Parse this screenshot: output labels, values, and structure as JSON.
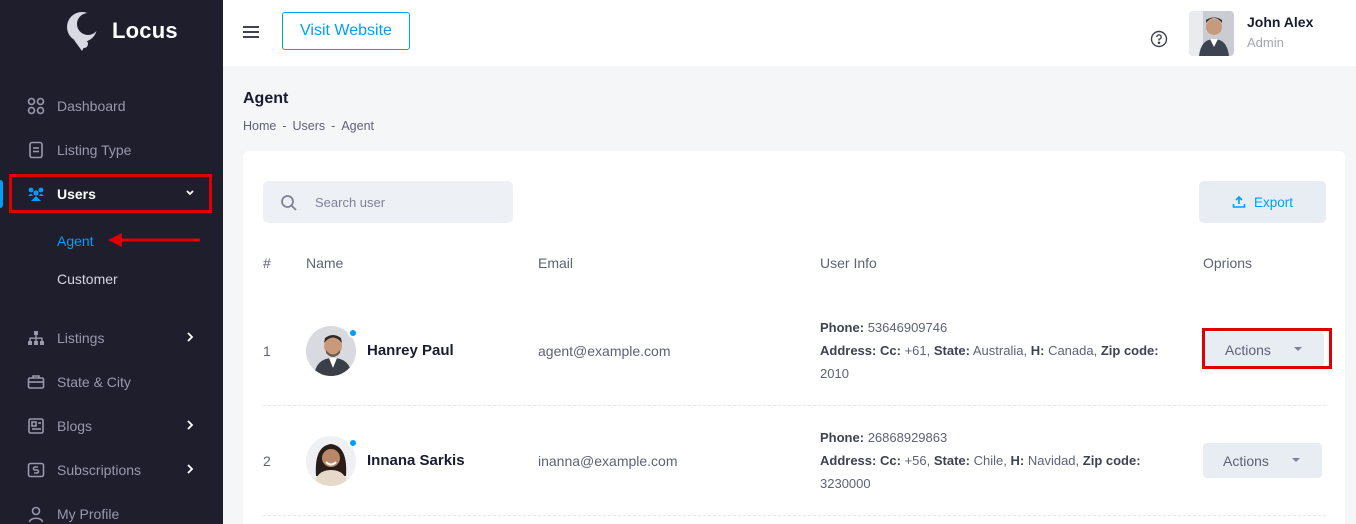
{
  "app": {
    "name": "Locus"
  },
  "colors": {
    "sidebar_bg": "#1e1e2d",
    "accent": "#009ef7",
    "highlight": "#e00000"
  },
  "sidebar": {
    "items": [
      {
        "label": "Dashboard",
        "icon": "dashboard-icon"
      },
      {
        "label": "Listing Type",
        "icon": "document-icon"
      },
      {
        "label": "Users",
        "icon": "users-icon",
        "active": true,
        "expanded": true
      },
      {
        "label": "Listings",
        "icon": "sitemap-icon"
      },
      {
        "label": "State & City",
        "icon": "briefcase-icon"
      },
      {
        "label": "Blogs",
        "icon": "newspaper-icon"
      },
      {
        "label": "Subscriptions",
        "icon": "subscription-icon"
      },
      {
        "label": "My Profile",
        "icon": "person-icon"
      }
    ],
    "sub_items": [
      {
        "label": "Agent",
        "active": true
      },
      {
        "label": "Customer"
      }
    ]
  },
  "header": {
    "visit_label": "Visit Website",
    "user": {
      "name": "John Alex",
      "role": "Admin"
    }
  },
  "page": {
    "title": "Agent",
    "breadcrumb": [
      "Home",
      "-",
      "Users",
      "-",
      "Agent"
    ]
  },
  "toolbar": {
    "search_placeholder": "Search user",
    "export_label": "Export"
  },
  "table": {
    "headers": [
      "#",
      "Name",
      "Email",
      "User Info",
      "Oprions"
    ],
    "rows": [
      {
        "num": "1",
        "name": "Hanrey Paul",
        "email": "agent@example.com",
        "phone_label": "Phone:",
        "phone": "53646909746",
        "address_label": "Address:",
        "cc_label": "Cc:",
        "cc": "+61,",
        "state_label": "State:",
        "state": "Australia,",
        "h_label": "H:",
        "h": "Canada,",
        "zip_label": "Zip code:",
        "zip": "2010",
        "action_label": "Actions"
      },
      {
        "num": "2",
        "name": "Innana Sarkis",
        "email": "inanna@example.com",
        "phone_label": "Phone:",
        "phone": "26868929863",
        "address_label": "Address:",
        "cc_label": "Cc:",
        "cc": "+56,",
        "state_label": "State:",
        "state": "Chile,",
        "h_label": "H:",
        "h": "Navidad,",
        "zip_label": "Zip code:",
        "zip": "3230000",
        "action_label": "Actions"
      }
    ]
  }
}
